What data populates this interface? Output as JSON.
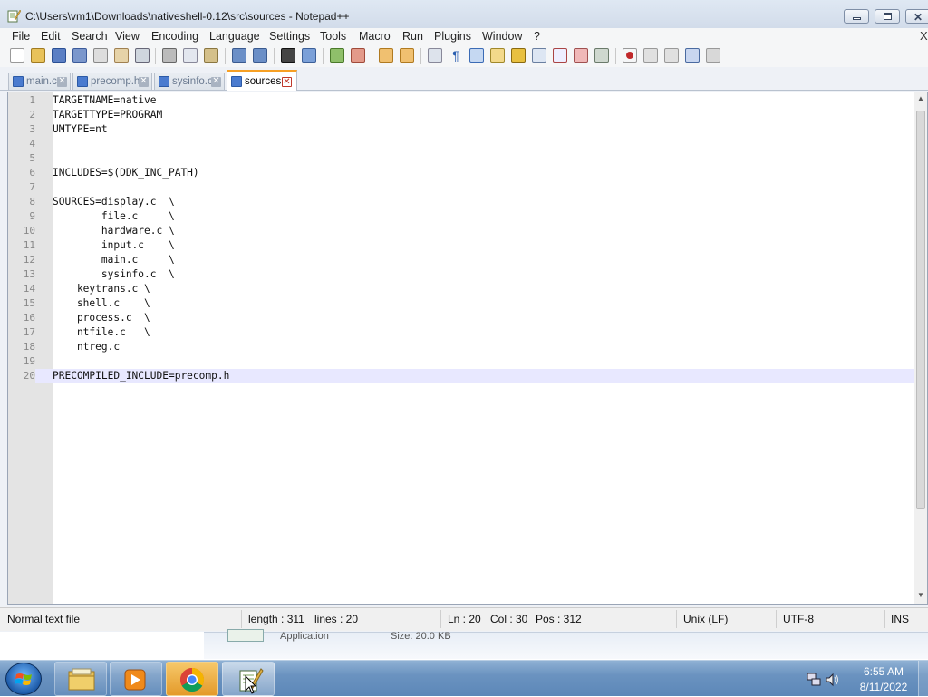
{
  "window": {
    "title": "C:\\Users\\vm1\\Downloads\\nativeshell-0.12\\src\\sources - Notepad++"
  },
  "menu": [
    "File",
    "Edit",
    "Search",
    "View",
    "Encoding",
    "Language",
    "Settings",
    "Tools",
    "Macro",
    "Run",
    "Plugins",
    "Window",
    "?"
  ],
  "menu_close": "X",
  "tabs": [
    {
      "label": "main.c",
      "active": false
    },
    {
      "label": "precomp.h",
      "active": false
    },
    {
      "label": "sysinfo.c",
      "active": false
    },
    {
      "label": "sources",
      "active": true
    }
  ],
  "editor": {
    "current_line": 20,
    "lines": [
      {
        "num": "1",
        "text": "TARGETNAME=native"
      },
      {
        "num": "2",
        "text": "TARGETTYPE=PROGRAM"
      },
      {
        "num": "3",
        "text": "UMTYPE=nt"
      },
      {
        "num": "4",
        "text": ""
      },
      {
        "num": "5",
        "text": ""
      },
      {
        "num": "6",
        "text": "INCLUDES=$(DDK_INC_PATH)"
      },
      {
        "num": "7",
        "text": ""
      },
      {
        "num": "8",
        "text": "SOURCES=display.c  \\"
      },
      {
        "num": "9",
        "text": "        file.c     \\"
      },
      {
        "num": "10",
        "text": "        hardware.c \\"
      },
      {
        "num": "11",
        "text": "        input.c    \\"
      },
      {
        "num": "12",
        "text": "        main.c     \\"
      },
      {
        "num": "13",
        "text": "        sysinfo.c  \\"
      },
      {
        "num": "14",
        "text": "    keytrans.c \\"
      },
      {
        "num": "15",
        "text": "    shell.c    \\"
      },
      {
        "num": "16",
        "text": "    process.c  \\"
      },
      {
        "num": "17",
        "text": "    ntfile.c   \\"
      },
      {
        "num": "18",
        "text": "    ntreg.c"
      },
      {
        "num": "19",
        "text": ""
      },
      {
        "num": "20",
        "text": "PRECOMPILED_INCLUDE=precomp.h"
      }
    ]
  },
  "status": {
    "file_type": "Normal text file",
    "length": "length : 311",
    "lines": "lines : 20",
    "ln": "Ln : 20",
    "col": "Col : 30",
    "pos": "Pos : 312",
    "eol": "Unix (LF)",
    "encoding": "UTF-8",
    "mode": "INS"
  },
  "background_window": {
    "type_text": "Application",
    "size_text": "Size: 20.0 KB"
  },
  "taskbar": {
    "time": "6:55 AM",
    "date": "8/11/2022",
    "buttons": [
      "explorer-icon",
      "media-player-icon",
      "chrome-icon",
      "notepadpp-icon"
    ]
  },
  "colors": {
    "tab_accent": "#f7a024",
    "current_line_bg": "#e8e8ff",
    "gutter_bg": "#e4e4e4"
  }
}
